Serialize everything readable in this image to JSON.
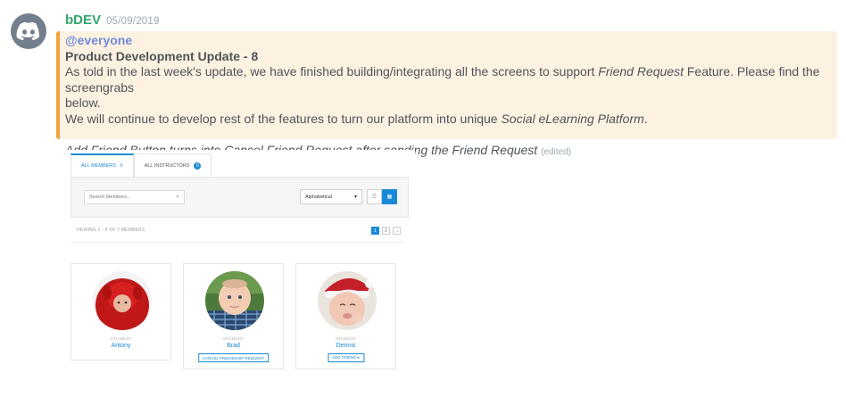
{
  "message": {
    "author": "bDEV",
    "timestamp": "05/09/2019",
    "mention": "@everyone",
    "title": "Product Development Update - 8",
    "line1_prefix": "As told in the last week's update, we have finished  building/integrating all the screens to support ",
    "line1_em": "Friend Request",
    "line1_suffix": " Feature. Please find the screengrabs",
    "line2": "below.",
    "line3_prefix": "We will continue to develop rest of the features to turn our platform into unique ",
    "line3_em": "Social eLearning Platform",
    "line3_suffix": ".",
    "caption": "Add Friend Button turns into Cancel Friend Request after sending the Friend Request",
    "edited": "(edited)"
  },
  "screenshot": {
    "tabs": [
      {
        "label": "ALL MEMBERS",
        "count": "6"
      },
      {
        "label": "ALL INSTRUCTORS",
        "count": "0"
      }
    ],
    "search_placeholder": "Search Members...",
    "sort_value": "Alphabetical",
    "viewing_text": "VIEWING 1 - 5 OF 7 MEMBERS",
    "pages": [
      "1",
      "2",
      "→"
    ],
    "members": [
      {
        "role": "STUDENT",
        "name": "Antony",
        "button": ""
      },
      {
        "role": "STUDENT",
        "name": "Brad",
        "button": "CANCEL FRIENDSHIP REQUEST"
      },
      {
        "role": "STUDENT",
        "name": "Dennis",
        "button": "ADD FRIEND ▸"
      }
    ]
  },
  "icons": {
    "avatar": "discord-logo-icon",
    "search": "search-icon",
    "list_view": "list-view-icon",
    "grid_view": "grid-view-icon"
  },
  "colors": {
    "author": "#2ea86b",
    "mention": "#7289da",
    "highlight_bg": "#fdf1e1",
    "highlight_border": "#f2a23c",
    "accent": "#1a8ad6"
  }
}
